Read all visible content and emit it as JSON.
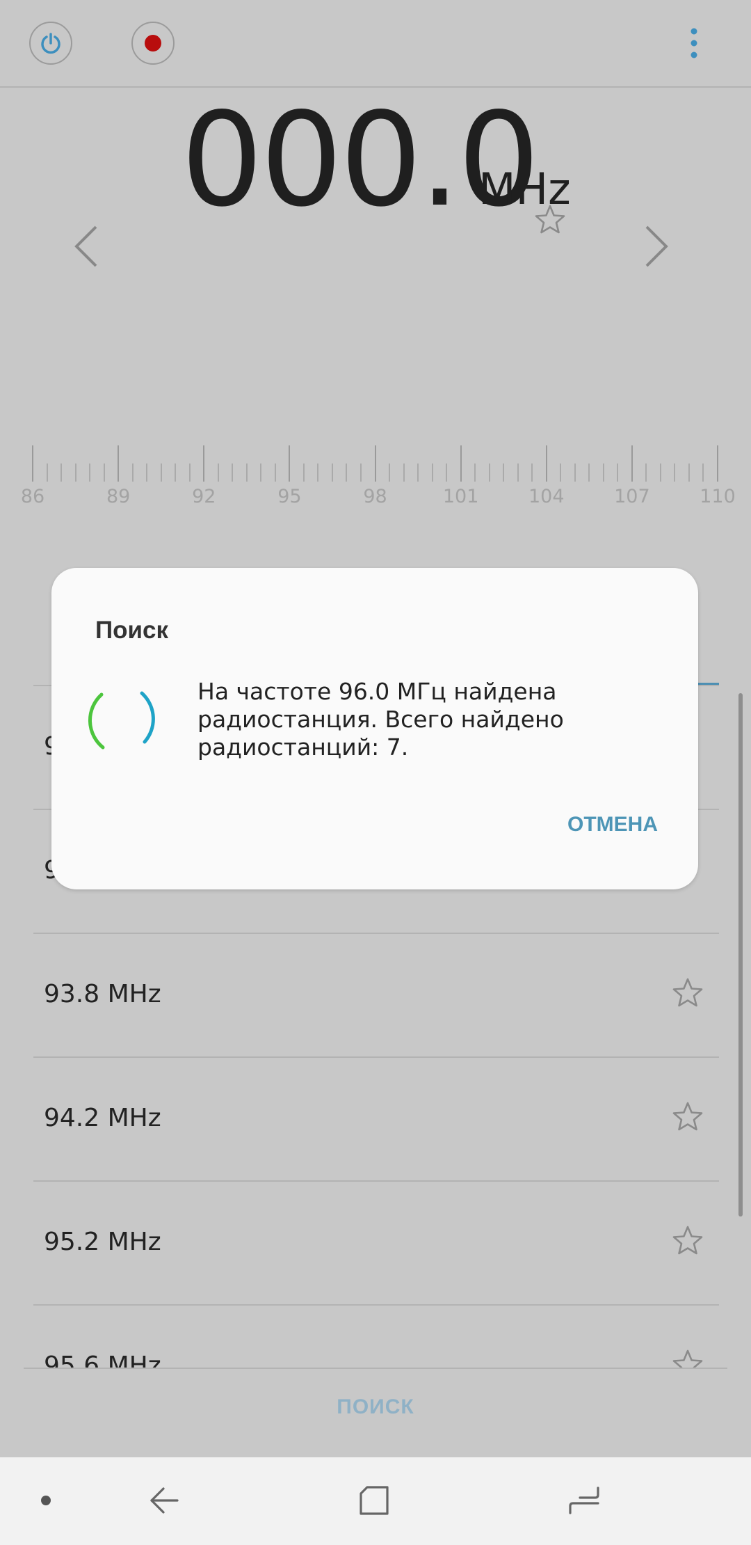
{
  "top_bar": {
    "power_icon": "power-icon",
    "record_icon": "record-icon",
    "more_icon": "more-vertical-icon"
  },
  "tuner": {
    "frequency": "000.0",
    "unit": "MHz",
    "prev_icon": "chevron-left-icon",
    "next_icon": "chevron-right-icon",
    "favorite_icon": "star-outline-icon"
  },
  "scale": {
    "labels": [
      "86",
      "89",
      "92",
      "95",
      "98",
      "101",
      "104",
      "107",
      "110"
    ]
  },
  "stations": [
    {
      "label": "93.8 MHz"
    },
    {
      "label": "94.2 MHz"
    },
    {
      "label": "95.2 MHz"
    },
    {
      "label": "95.6 MHz"
    }
  ],
  "bottom": {
    "search_label": "ПОИСК"
  },
  "dialog": {
    "title": "Поиск",
    "message": "На частоте 96.0 МГц найдена радиостанция. Всего найдено радиостанций: 7.",
    "cancel_label": "ОТМЕНА"
  },
  "navbar": {
    "items": [
      "dot-icon",
      "back-icon",
      "home-icon",
      "recent-apps-icon"
    ]
  },
  "colors": {
    "accent": "#4d95b6",
    "record": "#b80d0d",
    "spinner_green": "#4cc53d",
    "spinner_blue": "#1ea3c7"
  }
}
